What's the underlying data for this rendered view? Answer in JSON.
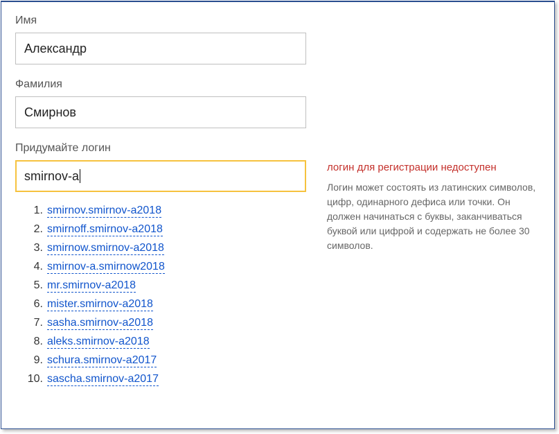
{
  "form": {
    "name": {
      "label": "Имя",
      "value": "Александр"
    },
    "surname": {
      "label": "Фамилия",
      "value": "Смирнов"
    },
    "login": {
      "label": "Придумайте логин",
      "value": "smirnov-a"
    }
  },
  "hint": {
    "error": "логин для регистрации недоступен",
    "text": "Логин может состоять из латинских символов, цифр, одинарного дефиса или точки. Он должен начинаться с буквы, заканчиваться буквой или цифрой и содержать не более 30 символов."
  },
  "suggestions": [
    "smirnov.smirnov-a2018",
    "smirnoff.smirnov-a2018",
    "smirnow.smirnov-a2018",
    "smirnov-a.smirnow2018",
    "mr.smirnov-a2018",
    "mister.smirnov-a2018",
    "sasha.smirnov-a2018",
    "aleks.smirnov-a2018",
    "schura.smirnov-a2017",
    "sascha.smirnov-a2017"
  ]
}
